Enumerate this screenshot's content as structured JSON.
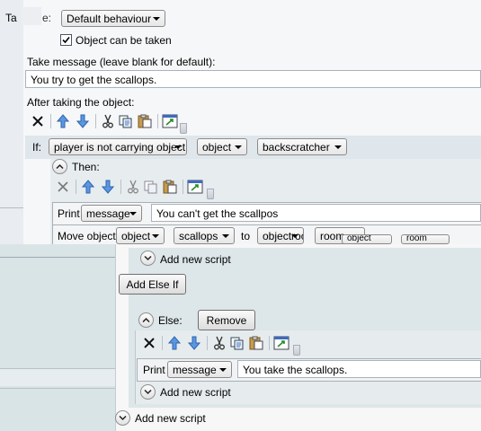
{
  "take": {
    "label_partial": "Ta",
    "label_partial2": "e:",
    "behaviour_value": "Default behaviour",
    "checkbox_label": "Object can be taken",
    "checkbox_checked": true,
    "message_label": "Take message (leave blank for default):",
    "message_value": "You try to get the scallops.",
    "after_label": "After taking the object:"
  },
  "if_block": {
    "if_label": "If:",
    "condition": "player is not carrying object",
    "object_type": "object",
    "object_value": "backscratcher",
    "then_label": "Then:",
    "print_label": "Print",
    "print_mode": "message",
    "print_value": "You can't get the scallpos",
    "move_label": "Move object",
    "move_type": "object",
    "move_value": "scallops",
    "to_label": "to",
    "to_type": "objectroom",
    "to_partial1": "room",
    "to_partial2": "object",
    "to_partial3": "room"
  },
  "front": {
    "add_new_script_1": "Add new script",
    "add_else_if": "Add Else If",
    "else_label": "Else:",
    "remove_label": "Remove",
    "print_label": "Print",
    "print_mode": "message",
    "print_value": "You take the scallops.",
    "add_new_script_2": "Add new script",
    "add_new_script_3": "Add new script"
  },
  "colors": {
    "panel": "#f6f7f8",
    "if_row": "#dfe6ec",
    "front_block": "#dde6e8",
    "arrow_blue": "#3d7fd6"
  },
  "icons": [
    "delete-icon",
    "move-up-icon",
    "move-down-icon",
    "cut-icon",
    "copy-icon",
    "paste-icon",
    "code-view-icon",
    "collapse-icon",
    "expand-icon",
    "checkmark-icon"
  ]
}
